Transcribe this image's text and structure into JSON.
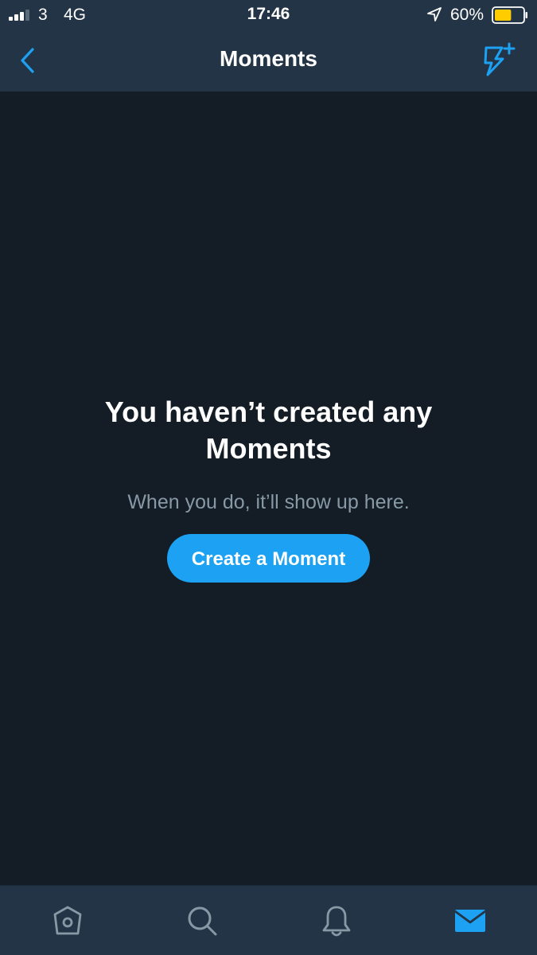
{
  "status_bar": {
    "carrier": "3",
    "network": "4G",
    "time": "17:46",
    "battery_percent": "60%",
    "battery_level": 0.6,
    "battery_color": "#ffcc00"
  },
  "nav": {
    "title": "Moments",
    "back_icon": "chevron-left-icon",
    "action_icon": "lightning-plus-icon",
    "accent": "#1da1f2"
  },
  "empty_state": {
    "title": "You haven’t created any Moments",
    "subtitle": "When you do, it’ll show up here.",
    "button_label": "Create a Moment"
  },
  "tab_bar": {
    "items": [
      {
        "name": "home-icon",
        "active": false
      },
      {
        "name": "search-icon",
        "active": false
      },
      {
        "name": "notifications-icon",
        "active": false
      },
      {
        "name": "messages-icon",
        "active": true
      }
    ],
    "inactive_color": "#8899a6",
    "active_color": "#1da1f2"
  }
}
